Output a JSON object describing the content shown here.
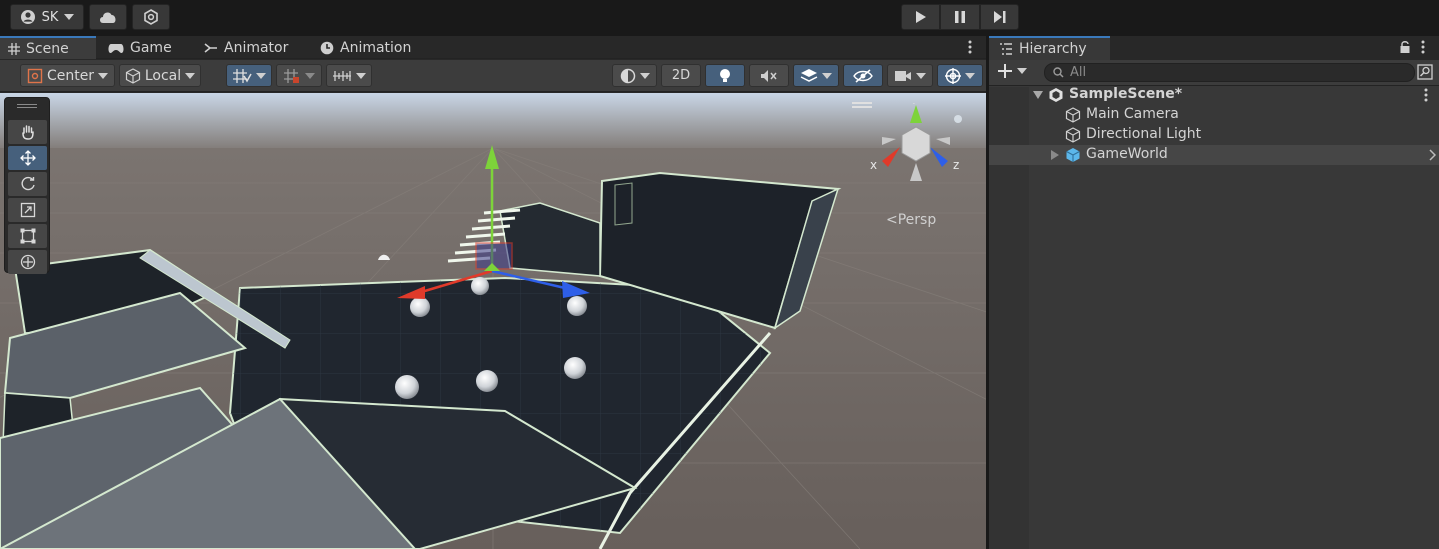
{
  "toolbar": {
    "account_label": "SK"
  },
  "scene_view": {
    "tabs": [
      {
        "label": "Scene",
        "icon": "grid-icon"
      },
      {
        "label": "Game",
        "icon": "gamepad-icon"
      },
      {
        "label": "Animator",
        "icon": "animator-icon"
      },
      {
        "label": "Animation",
        "icon": "clock-icon"
      }
    ],
    "pivot_mode": "Center",
    "pivot_rotation": "Local",
    "toggle_2d": "2D",
    "projection_label": "Persp",
    "gizmo_axes": {
      "x": "x",
      "y": "y",
      "z": "z"
    },
    "colors": {
      "x_axis": "#e03a2a",
      "y_axis": "#7dd33a",
      "z_axis": "#2e5fe8",
      "selection": "#46607c"
    }
  },
  "hierarchy": {
    "tab_label": "Hierarchy",
    "search_placeholder": "All",
    "scene_name": "SampleScene*",
    "items": [
      {
        "label": "Main Camera",
        "icon": "gameobject-icon"
      },
      {
        "label": "Directional Light",
        "icon": "gameobject-icon"
      },
      {
        "label": "GameWorld",
        "icon": "prefab-icon"
      }
    ]
  }
}
